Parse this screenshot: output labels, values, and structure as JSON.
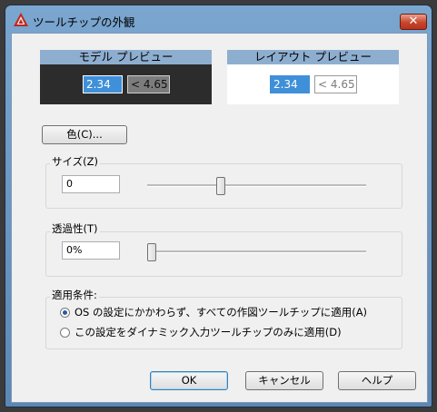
{
  "window": {
    "title": "ツールチップの外観",
    "close_glyph": "✕"
  },
  "model_preview": {
    "header": "モデル プレビュー",
    "value": "2.34",
    "other": "< 4.65"
  },
  "layout_preview": {
    "header": "レイアウト プレビュー",
    "value": "2.34",
    "other": "< 4.65"
  },
  "color_button": "色(C)...",
  "size": {
    "label": "サイズ(Z)",
    "value": "0"
  },
  "transparency": {
    "label": "透過性(T)",
    "value": "0%"
  },
  "apply": {
    "label": "適用条件:",
    "options": [
      {
        "label": "OS の設定にかかわらず、すべての作図ツールチップに適用(A)",
        "selected": true
      },
      {
        "label": "この設定をダイナミック入力ツールチップのみに適用(D)",
        "selected": false
      }
    ]
  },
  "buttons": {
    "ok": "OK",
    "cancel": "キャンセル",
    "help": "ヘルプ"
  }
}
